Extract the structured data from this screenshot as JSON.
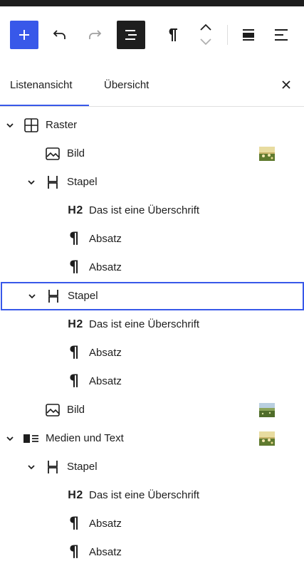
{
  "toolbar": {
    "add_icon": "plus-icon",
    "undo_icon": "undo-icon",
    "redo_icon": "redo-icon",
    "list_view_icon": "list-view-icon",
    "paragraph_icon": "paragraph-icon",
    "move_up_icon": "chevron-up-icon",
    "move_down_icon": "chevron-down-icon",
    "align_icon": "align-center-icon",
    "justify_icon": "justify-left-icon",
    "accent_color": "#3858e9"
  },
  "tabs": {
    "list_view": "Listenansicht",
    "overview": "Übersicht",
    "active": "Listenansicht",
    "close_icon": "close-icon"
  },
  "tree": {
    "rows": [
      {
        "label": "Raster",
        "icon": "grid-icon",
        "expanded": true
      },
      {
        "label": "Bild",
        "icon": "image-icon",
        "thumbnail": "flower-field-thumbnail"
      },
      {
        "label": "Stapel",
        "icon": "stack-icon",
        "expanded": true
      },
      {
        "label": "Das ist eine Überschrift",
        "icon_text": "H2"
      },
      {
        "label": "Absatz",
        "icon_text": "¶"
      },
      {
        "label": "Absatz",
        "icon_text": "¶"
      },
      {
        "label": "Stapel",
        "icon": "stack-icon",
        "expanded": true,
        "selected": true
      },
      {
        "label": "Das ist eine Überschrift",
        "icon_text": "H2"
      },
      {
        "label": "Absatz",
        "icon_text": "¶"
      },
      {
        "label": "Absatz",
        "icon_text": "¶"
      },
      {
        "label": "Bild",
        "icon": "image-icon",
        "thumbnail": "meadow-thumbnail"
      },
      {
        "label": "Medien und Text",
        "icon": "media-text-icon",
        "expanded": true,
        "thumbnail": "flower-field-thumbnail"
      },
      {
        "label": "Stapel",
        "icon": "stack-icon",
        "expanded": true
      },
      {
        "label": "Das ist eine Überschrift",
        "icon_text": "H2"
      },
      {
        "label": "Absatz",
        "icon_text": "¶"
      },
      {
        "label": "Absatz",
        "icon_text": "¶"
      }
    ]
  }
}
